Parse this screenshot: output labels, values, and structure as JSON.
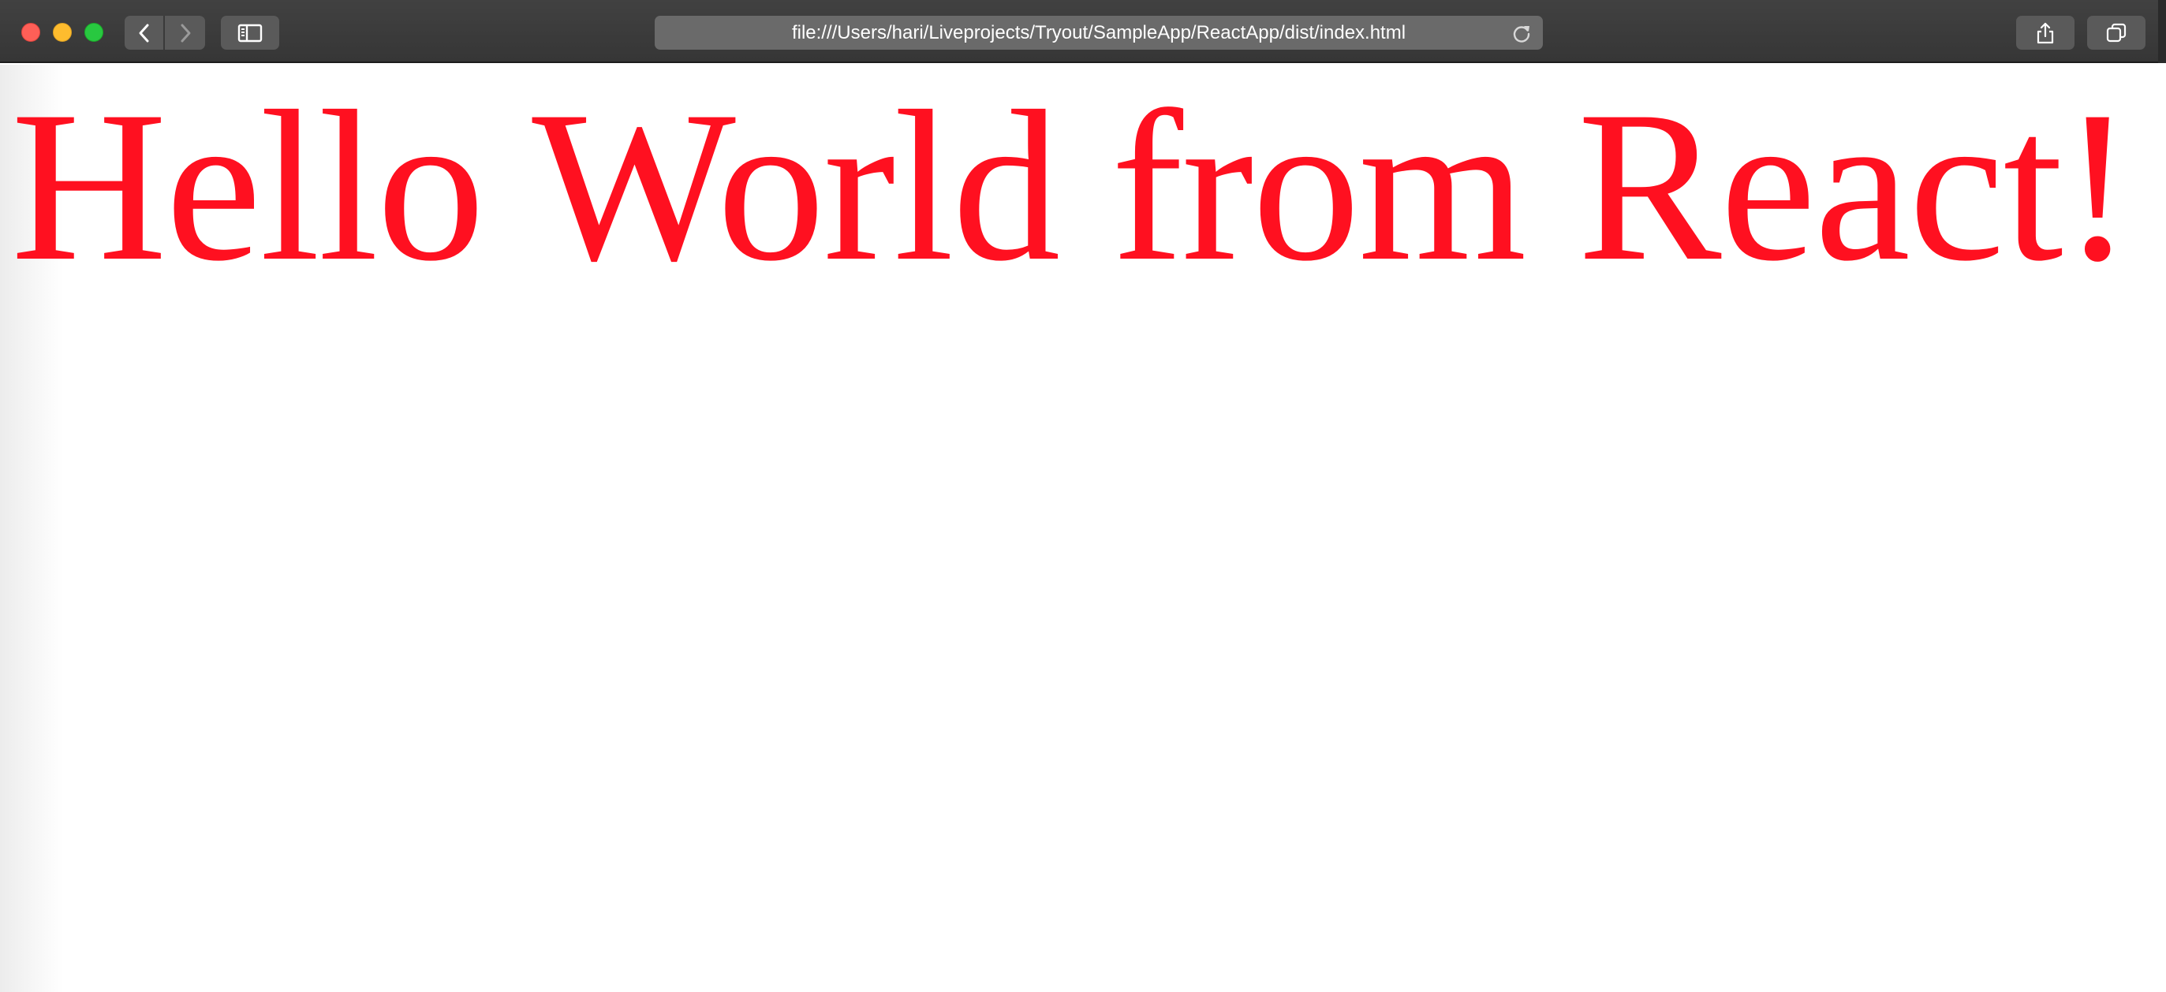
{
  "browser": {
    "url": "file:///Users/hari/Liveprojects/Tryout/SampleApp/ReactApp/dist/index.html",
    "icons": {
      "back": "chevron-left-icon",
      "forward": "chevron-right-icon",
      "sidebar": "sidebar-icon",
      "reload": "reload-icon",
      "share": "share-icon",
      "tabs": "tabs-overview-icon"
    },
    "colors": {
      "toolbar": "#3c3c3c",
      "close": "#fe5f57",
      "minimize": "#febc2e",
      "maximize": "#28c840"
    }
  },
  "page": {
    "heading": "Hello World from React!",
    "heading_color": "#ff1020"
  }
}
